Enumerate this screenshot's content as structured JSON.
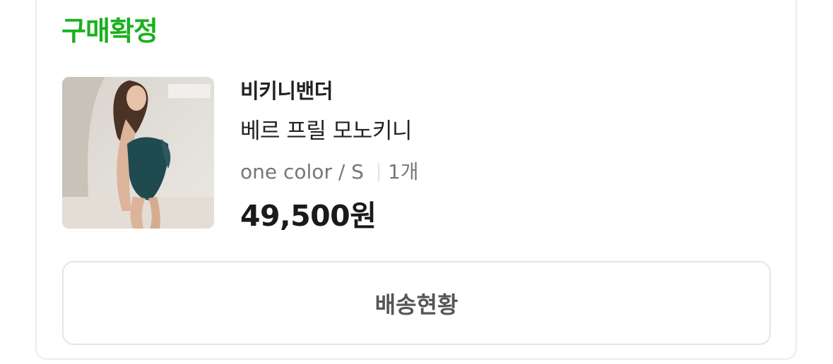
{
  "order": {
    "status_label": "구매확정",
    "status_color": "#19b11e"
  },
  "product": {
    "image_icon": "product-photo-swimsuit",
    "brand": "비키니밴더",
    "name": "베르 프릴 모노키니",
    "option": "one color / S",
    "quantity": "1개",
    "price": "49,500원"
  },
  "actions": {
    "delivery_status_label": "배송현황"
  }
}
